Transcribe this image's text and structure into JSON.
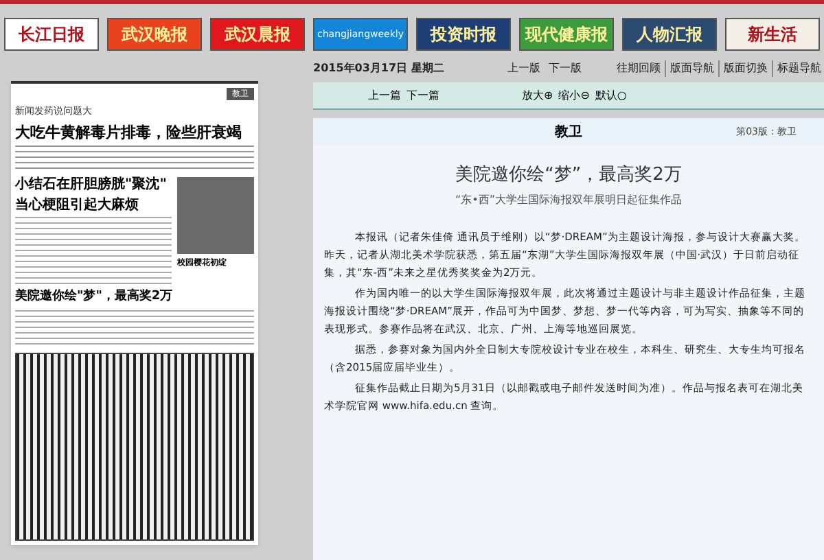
{
  "logos": [
    {
      "label": "长江日报",
      "color": "#ffffff"
    },
    {
      "label": "武汉晚报",
      "color": "#e8431e"
    },
    {
      "label": "武汉晨报",
      "color": "#e0181e"
    },
    {
      "label": "changjiangweekly",
      "color": "#1486d8"
    },
    {
      "label": "投资时报",
      "color": "#1d3f75"
    },
    {
      "label": "现代健康报",
      "color": "#3c9b3c"
    },
    {
      "label": "人物汇报",
      "color": "#2a4a70"
    },
    {
      "label": "新生活",
      "color": "#f4efe6"
    }
  ],
  "newspaper_page": {
    "section_tag": "教卫",
    "kicker": "新闻发药说问题大",
    "headline_1": "大吃牛黄解毒片排毒，险些肝衰竭",
    "headline_2": "小结石在肝胆膀胱\"聚沈\"",
    "headline_2b": "当心梗阻引起大麻烦",
    "photo_caption": "校园樱花初绽",
    "headline_3": "美院邀你绘\"梦\"，最高奖2万"
  },
  "date": "2015年03月17日 星期二",
  "page_nav": [
    "上一版",
    "下一版"
  ],
  "top_links": [
    "往期回顾",
    "版面导航",
    "版面切换",
    "标题导航"
  ],
  "article_nav": {
    "prev": "上一篇",
    "next": "下一篇"
  },
  "zoom_controls": [
    {
      "label": "放大",
      "symbol": "⊕"
    },
    {
      "label": "缩小",
      "symbol": "⊖"
    },
    {
      "label": "默认",
      "symbol": "○"
    }
  ],
  "section": {
    "title": "教卫",
    "page_label": "第03版：教卫"
  },
  "article": {
    "title": "美院邀你绘“梦”，最高奖2万",
    "subtitle": "“东•西”大学生国际海报双年展明日起征集作品",
    "paragraphs": [
      "本报讯（记者朱佳倚 通讯员于维刚）以“梦·DREAM”为主题设计海报，参与设计大赛赢大奖。昨天，记者从湖北美术学院获悉，第五届“东湖”大学生国际海报双年展（中国·武汉）于日前启动征集，其“东-西”未来之星优秀奖奖金为2万元。",
      "作为国内唯一的以大学生国际海报双年展，此次将通过主题设计与非主题设计作品征集，主题海报设计围绕“梦·DREAM”展开，作品可为中国梦、梦想、梦一代等内容，可为写实、抽象等不同的表现形式。参赛作品将在武汉、北京、广州、上海等地巡回展览。",
      "据悉，参赛对象为国内外全日制大专院校设计专业在校生，本科生、研究生、大专生均可报名（含2015届应届毕业生）。",
      "征集作品截止日期为5月31日（以邮戳或电子邮件发送时间为准）。作品与报名表可在湖北美术学院官网 www.hifa.edu.cn 查询。"
    ]
  }
}
